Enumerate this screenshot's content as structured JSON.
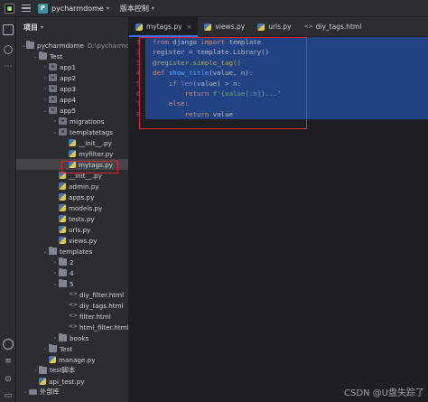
{
  "titlebar": {
    "project_badge": "P",
    "project_name": "pycharmdome",
    "vcs_label": "版本控制"
  },
  "panel": {
    "title": "项目"
  },
  "tree": [
    {
      "label": "pycharmdome",
      "suffix": "D:\\pycharmdom",
      "depth": 0,
      "expanded": true,
      "icon": "folder"
    },
    {
      "label": "Test",
      "depth": 1,
      "expanded": true,
      "icon": "folder"
    },
    {
      "label": "app1",
      "depth": 2,
      "expanded": false,
      "icon": "pkg"
    },
    {
      "label": "app2",
      "depth": 2,
      "expanded": false,
      "icon": "pkg"
    },
    {
      "label": "app3",
      "depth": 2,
      "expanded": false,
      "icon": "pkg"
    },
    {
      "label": "app4",
      "depth": 2,
      "expanded": false,
      "icon": "pkg"
    },
    {
      "label": "app5",
      "depth": 2,
      "expanded": true,
      "icon": "pkg"
    },
    {
      "label": "migrations",
      "depth": 3,
      "expanded": false,
      "icon": "pkg"
    },
    {
      "label": "templatetags",
      "depth": 3,
      "expanded": true,
      "icon": "pkg"
    },
    {
      "label": "__init__.py",
      "depth": 4,
      "icon": "py"
    },
    {
      "label": "myfilter.py",
      "depth": 4,
      "icon": "py"
    },
    {
      "label": "mytags.py",
      "depth": 4,
      "icon": "py",
      "selected": true
    },
    {
      "label": "__init__.py",
      "depth": 3,
      "icon": "py"
    },
    {
      "label": "admin.py",
      "depth": 3,
      "icon": "py"
    },
    {
      "label": "apps.py",
      "depth": 3,
      "icon": "py"
    },
    {
      "label": "models.py",
      "depth": 3,
      "icon": "py"
    },
    {
      "label": "tests.py",
      "depth": 3,
      "icon": "py"
    },
    {
      "label": "urls.py",
      "depth": 3,
      "icon": "py"
    },
    {
      "label": "views.py",
      "depth": 3,
      "icon": "py"
    },
    {
      "label": "templates",
      "depth": 2,
      "expanded": true,
      "icon": "folder"
    },
    {
      "label": "2",
      "depth": 3,
      "expanded": false,
      "icon": "folder"
    },
    {
      "label": "4",
      "depth": 3,
      "expanded": false,
      "icon": "folder"
    },
    {
      "label": "5",
      "depth": 3,
      "expanded": true,
      "icon": "folder"
    },
    {
      "label": "diy_filter.html",
      "depth": 4,
      "icon": "html"
    },
    {
      "label": "diy_tags.html",
      "depth": 4,
      "icon": "html"
    },
    {
      "label": "filter.html",
      "depth": 4,
      "icon": "html"
    },
    {
      "label": "html_filter.html",
      "depth": 4,
      "icon": "html"
    },
    {
      "label": "books",
      "depth": 3,
      "expanded": false,
      "icon": "folder"
    },
    {
      "label": "Test",
      "depth": 2,
      "expanded": false,
      "icon": "folder"
    },
    {
      "label": "manage.py",
      "depth": 2,
      "icon": "py"
    },
    {
      "label": "test脚本",
      "depth": 1,
      "expanded": false,
      "icon": "folder"
    },
    {
      "label": "api_test.py",
      "depth": 1,
      "icon": "py"
    },
    {
      "label": "外部库",
      "depth": 0,
      "expanded": false,
      "icon": "lib"
    }
  ],
  "tabs": [
    {
      "label": "mytags.py",
      "icon": "py",
      "active": true,
      "closable": true
    },
    {
      "label": "views.py",
      "icon": "py"
    },
    {
      "label": "urls.py",
      "icon": "py"
    },
    {
      "label": "diy_tags.html",
      "icon": "html"
    }
  ],
  "editor": {
    "line_numbers": [
      "1",
      "2",
      "3",
      "4",
      "5",
      "6",
      "7",
      "8"
    ],
    "code_lines": [
      [
        {
          "t": "from ",
          "c": "kw"
        },
        {
          "t": "django ",
          "c": ""
        },
        {
          "t": "import ",
          "c": "kw"
        },
        {
          "t": "template",
          "c": ""
        }
      ],
      [
        {
          "t": "register = template.Library()",
          "c": ""
        }
      ],
      [
        {
          "t": "@register.simple_tag()",
          "c": "dec"
        }
      ],
      [
        {
          "t": "def ",
          "c": "kw"
        },
        {
          "t": "show_title",
          "c": "fn"
        },
        {
          "t": "(value, n):",
          "c": ""
        }
      ],
      [
        {
          "t": "    ",
          "c": ""
        },
        {
          "t": "if ",
          "c": "kw"
        },
        {
          "t": "len",
          "c": "bi"
        },
        {
          "t": "(value) > n:",
          "c": ""
        }
      ],
      [
        {
          "t": "        ",
          "c": ""
        },
        {
          "t": "return ",
          "c": "kw"
        },
        {
          "t": "f'{value[:n]}...'",
          "c": "str"
        }
      ],
      [
        {
          "t": "    ",
          "c": ""
        },
        {
          "t": "else",
          "c": "kw"
        },
        {
          "t": ":",
          "c": ""
        }
      ],
      [
        {
          "t": "        ",
          "c": ""
        },
        {
          "t": "return ",
          "c": "kw"
        },
        {
          "t": "value",
          "c": ""
        }
      ]
    ]
  },
  "watermark": "CSDN @U盘失踪了"
}
